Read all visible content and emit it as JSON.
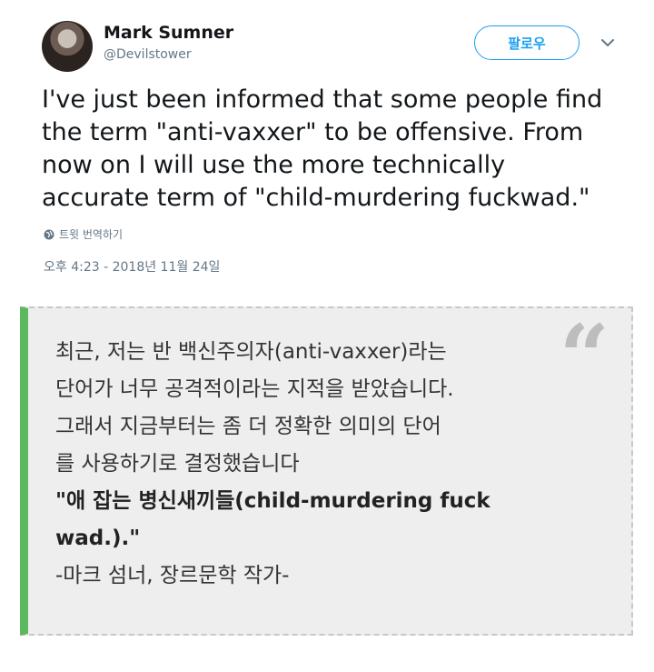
{
  "user": {
    "name": "Mark Sumner",
    "handle": "@Devilstower"
  },
  "follow_label": "팔로우",
  "tweet": {
    "lines": [
      "I've just been informed that some people find",
      "the term \"anti-vaxxer\" to be offensive. From",
      "now on I will use the more technically",
      "accurate term of \"child-murdering fuckwad.\""
    ],
    "translate_label": "트윗 번역하기",
    "timestamp": "오후 4:23 - 2018년 11월 24일"
  },
  "quote": {
    "mark": "“",
    "lines": [
      {
        "text": "최근, 저는 반 백신주의자(anti-vaxxer)라는",
        "bold": false
      },
      {
        "text": "단어가 너무 공격적이라는 지적을 받았습니다.",
        "bold": false
      },
      {
        "text": "그래서 지금부터는 좀 더 정확한 의미의 단어",
        "bold": false
      },
      {
        "text": "를 사용하기로 결정했습니다",
        "bold": false
      },
      {
        "text": "\"애 잡는 병신새끼들(child-murdering fuck",
        "bold": true
      },
      {
        "text": "wad.).\"",
        "bold": true
      },
      {
        "text": "-마크 섬너, 장르문학 작가-",
        "bold": false
      }
    ],
    "accent_color": "#5cb85c"
  }
}
